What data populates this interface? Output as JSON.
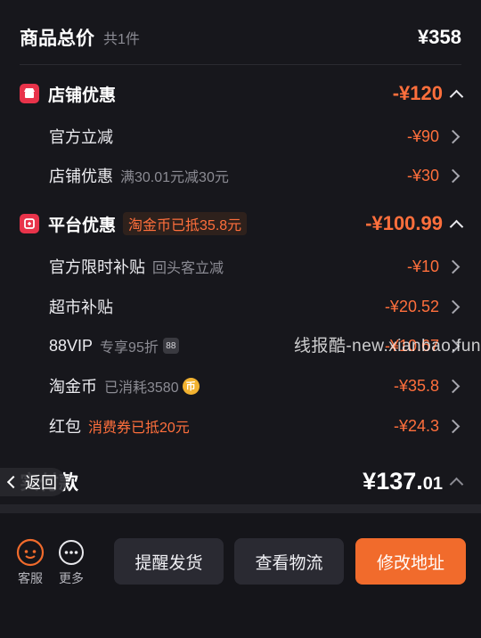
{
  "summary": {
    "title": "商品总价",
    "count": "共1件",
    "total": "¥358"
  },
  "store_discount": {
    "title": "店铺优惠",
    "amount": "-¥120",
    "items": [
      {
        "label": "官方立减",
        "note": "",
        "amount": "-¥90"
      },
      {
        "label": "店铺优惠",
        "note": "满30.01元减30元",
        "amount": "-¥30"
      }
    ]
  },
  "platform_discount": {
    "title": "平台优惠",
    "tag": "淘金币已抵35.8元",
    "amount": "-¥100.99",
    "items": [
      {
        "label": "官方限时补贴",
        "note": "回头客立减",
        "amount": "-¥10"
      },
      {
        "label": "超市补贴",
        "note": "",
        "amount": "-¥20.52"
      },
      {
        "label": "88VIP",
        "note": "专享95折",
        "badge": "88",
        "amount": "-¥10.67"
      },
      {
        "label": "淘金币",
        "note": "已消耗3580",
        "coin": "币",
        "amount": "-¥35.8"
      },
      {
        "label": "红包",
        "note": "消费券已抵20元",
        "amount": "-¥24.3"
      }
    ]
  },
  "paid": {
    "label": "实付款",
    "amount_main": "¥137.",
    "amount_cents": "01"
  },
  "overlay": {
    "watermark": "线报酷-new.xianbao.fun",
    "back": "返回"
  },
  "footer": {
    "service_label": "客服",
    "more_label": "更多",
    "buttons": [
      "提醒发货",
      "查看物流",
      "修改地址"
    ]
  },
  "colors": {
    "accent": "#ff6f3c",
    "primary_button": "#f16b2c",
    "store_icon": "#e8334a"
  }
}
